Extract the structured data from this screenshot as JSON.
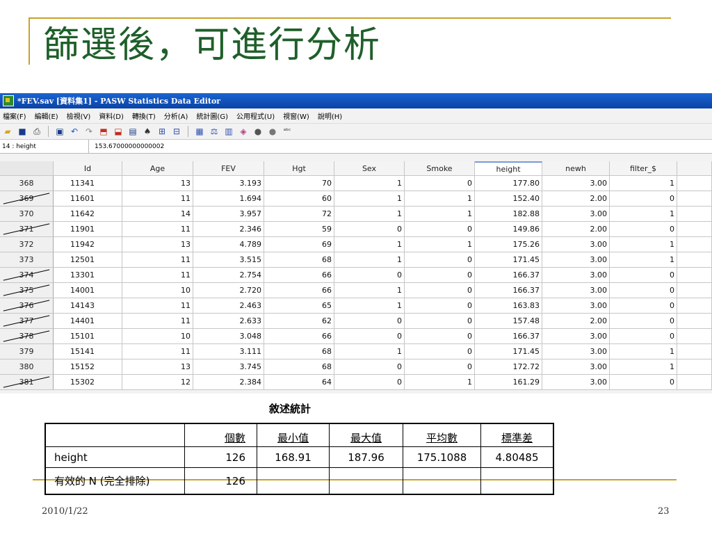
{
  "slide": {
    "title": "篩選後，可進行分析",
    "date": "2010/1/22",
    "page_number": "23",
    "accent_color": "#c9a227",
    "title_color": "#1f5f2a"
  },
  "window": {
    "title": "*FEV.sav [資料集1] - PASW Statistics Data Editor"
  },
  "menu": [
    "檔案(F)",
    "編輯(E)",
    "檢視(V)",
    "資料(D)",
    "轉換(T)",
    "分析(A)",
    "統計圖(G)",
    "公用程式(U)",
    "視窗(W)",
    "說明(H)"
  ],
  "toolbar_icons": [
    "open-folder-icon",
    "save-icon",
    "print-icon",
    "dialog-recall-icon",
    "undo-icon",
    "redo-icon",
    "goto-case-icon",
    "goto-variable-icon",
    "variables-icon",
    "find-icon",
    "insert-cases-icon",
    "insert-variable-icon",
    "split-file-icon",
    "weight-cases-icon",
    "select-cases-icon",
    "value-labels-icon",
    "use-sets-icon",
    "show-all-icon",
    "spelling-icon"
  ],
  "cell_ref": {
    "name": "14 : height",
    "value": "153.67000000000002"
  },
  "grid": {
    "columns": [
      "Id",
      "Age",
      "FEV",
      "Hgt",
      "Sex",
      "Smoke",
      "height",
      "newh",
      "filter_$"
    ],
    "active_column": "height",
    "rows": [
      {
        "num": "368",
        "filtered": false,
        "cells": [
          "11341",
          "13",
          "3.193",
          "70",
          "1",
          "0",
          "177.80",
          "3.00",
          "1"
        ]
      },
      {
        "num": "369",
        "filtered": true,
        "cells": [
          "11601",
          "11",
          "1.694",
          "60",
          "1",
          "1",
          "152.40",
          "2.00",
          "0"
        ]
      },
      {
        "num": "370",
        "filtered": false,
        "cells": [
          "11642",
          "14",
          "3.957",
          "72",
          "1",
          "1",
          "182.88",
          "3.00",
          "1"
        ]
      },
      {
        "num": "371",
        "filtered": true,
        "cells": [
          "11901",
          "11",
          "2.346",
          "59",
          "0",
          "0",
          "149.86",
          "2.00",
          "0"
        ]
      },
      {
        "num": "372",
        "filtered": false,
        "cells": [
          "11942",
          "13",
          "4.789",
          "69",
          "1",
          "1",
          "175.26",
          "3.00",
          "1"
        ]
      },
      {
        "num": "373",
        "filtered": false,
        "cells": [
          "12501",
          "11",
          "3.515",
          "68",
          "1",
          "0",
          "171.45",
          "3.00",
          "1"
        ]
      },
      {
        "num": "374",
        "filtered": true,
        "cells": [
          "13301",
          "11",
          "2.754",
          "66",
          "0",
          "0",
          "166.37",
          "3.00",
          "0"
        ]
      },
      {
        "num": "375",
        "filtered": true,
        "cells": [
          "14001",
          "10",
          "2.720",
          "66",
          "1",
          "0",
          "166.37",
          "3.00",
          "0"
        ]
      },
      {
        "num": "376",
        "filtered": true,
        "cells": [
          "14143",
          "11",
          "2.463",
          "65",
          "1",
          "0",
          "163.83",
          "3.00",
          "0"
        ]
      },
      {
        "num": "377",
        "filtered": true,
        "cells": [
          "14401",
          "11",
          "2.633",
          "62",
          "0",
          "0",
          "157.48",
          "2.00",
          "0"
        ]
      },
      {
        "num": "378",
        "filtered": true,
        "cells": [
          "15101",
          "10",
          "3.048",
          "66",
          "0",
          "0",
          "166.37",
          "3.00",
          "0"
        ]
      },
      {
        "num": "379",
        "filtered": false,
        "cells": [
          "15141",
          "11",
          "3.111",
          "68",
          "1",
          "0",
          "171.45",
          "3.00",
          "1"
        ]
      },
      {
        "num": "380",
        "filtered": false,
        "cells": [
          "15152",
          "13",
          "3.745",
          "68",
          "0",
          "0",
          "172.72",
          "3.00",
          "1"
        ]
      },
      {
        "num": "381",
        "filtered": true,
        "cells": [
          "15302",
          "12",
          "2.384",
          "64",
          "0",
          "1",
          "161.29",
          "3.00",
          "0"
        ]
      }
    ]
  },
  "stats": {
    "title": "敘述統計",
    "headers": [
      "",
      "個數",
      "最小值",
      "最大值",
      "平均數",
      "標準差"
    ],
    "rows": [
      [
        "height",
        "126",
        "168.91",
        "187.96",
        "175.1088",
        "4.80485"
      ],
      [
        "有效的 N (完全排除)",
        "126",
        "",
        "",
        "",
        ""
      ]
    ]
  }
}
